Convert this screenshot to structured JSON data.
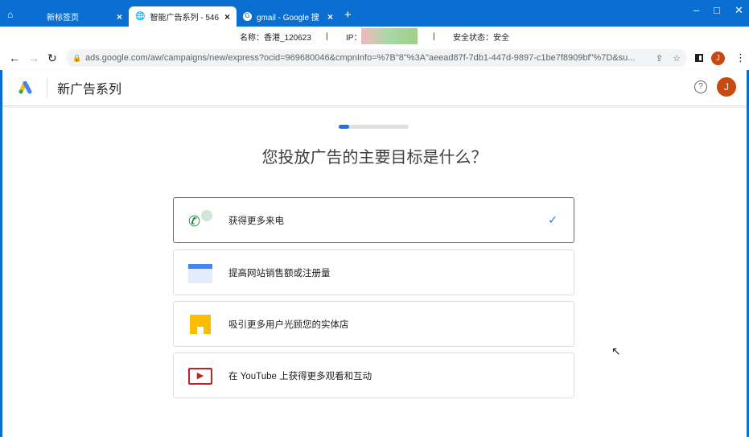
{
  "browser": {
    "tabs": [
      {
        "label": "新标签页"
      },
      {
        "label": "智能广告系列 - 546"
      },
      {
        "label": "gmail - Google 搜"
      }
    ],
    "info": {
      "name": "名称：香港_120623",
      "ip_label": "IP：",
      "security": "安全状态：安全"
    },
    "url": "ads.google.com/aw/campaigns/new/express?ocid=969680046&cmpnInfo=%7B\"8\"%3A\"aeead87f-7db1-447d-9897-c1be7f8909bf\"%7D&su...",
    "profile_initial": "J"
  },
  "app": {
    "title": "新广告系列",
    "avatar": "J",
    "progress": 0.15
  },
  "question": "您投放广告的主要目标是什么？",
  "options": [
    {
      "label": "获得更多来电",
      "selected": true
    },
    {
      "label": "提高网站销售额或注册量",
      "selected": false
    },
    {
      "label": "吸引更多用户光顾您的实体店",
      "selected": false
    },
    {
      "label": "在 YouTube 上获得更多观看和互动",
      "selected": false
    }
  ]
}
